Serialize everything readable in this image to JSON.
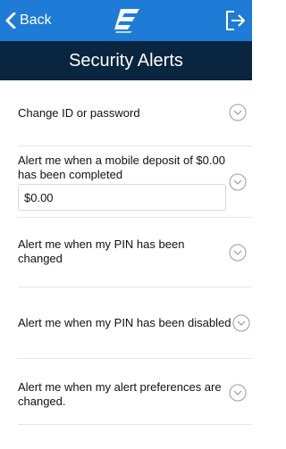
{
  "header": {
    "back_label": "Back",
    "title": "Security Alerts"
  },
  "alerts": [
    {
      "label": "Change ID or password"
    },
    {
      "label": "Alert me when a mobile deposit of $0.00 has been completed",
      "amount_value": "$0.00"
    },
    {
      "label": "Alert me when my PIN has been changed"
    },
    {
      "label": "Alert me when my PIN has been disabled"
    },
    {
      "label": "Alert me when my alert preferences are changed."
    }
  ],
  "colors": {
    "topbar": "#1e7bd6",
    "titlebar": "#0a2540",
    "chevron": "#9a9a9a"
  },
  "icons": [
    "chevron-left-icon",
    "app-logo",
    "logout-icon",
    "chevron-down-circle-icon"
  ]
}
